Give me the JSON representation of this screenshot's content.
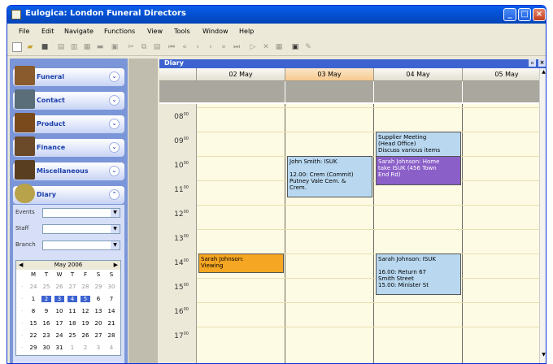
{
  "window": {
    "title": "Eulogica: London Funeral Directors"
  },
  "menu": [
    "File",
    "Edit",
    "Navigate",
    "Functions",
    "View",
    "Tools",
    "Window",
    "Help"
  ],
  "nav": [
    {
      "label": "Funeral",
      "icon": "funeral-icon",
      "color": "#8a5b2c"
    },
    {
      "label": "Contact",
      "icon": "contact-icon",
      "color": "#5a6e7a"
    },
    {
      "label": "Product",
      "icon": "product-icon",
      "color": "#7a4a1c"
    },
    {
      "label": "Finance",
      "icon": "finance-icon",
      "color": "#6b4a2a"
    },
    {
      "label": "Miscellaneous",
      "icon": "miscellaneous-icon",
      "color": "#5a3e20"
    },
    {
      "label": "Diary",
      "icon": "diary-icon",
      "color": "#b8a24a"
    }
  ],
  "filters": {
    "events": "Events",
    "staff": "Staff",
    "branch": "Branch"
  },
  "calendar": {
    "month": "May 2006",
    "weekdays": [
      "M",
      "T",
      "W",
      "T",
      "F",
      "S",
      "S"
    ],
    "weeks": [
      [
        "24",
        "25",
        "26",
        "27",
        "28",
        "29",
        "30"
      ],
      [
        "1",
        "2",
        "3",
        "4",
        "5",
        "6",
        "7"
      ],
      [
        "8",
        "9",
        "10",
        "11",
        "12",
        "13",
        "14"
      ],
      [
        "15",
        "16",
        "17",
        "18",
        "19",
        "20",
        "21"
      ],
      [
        "22",
        "23",
        "24",
        "25",
        "26",
        "27",
        "28"
      ],
      [
        "29",
        "30",
        "31",
        "1",
        "2",
        "3",
        "4"
      ]
    ],
    "selected": [
      "2",
      "3",
      "4",
      "5"
    ]
  },
  "diary": {
    "title": "Diary",
    "days": [
      "02 May",
      "03 May",
      "04 May",
      "05 May"
    ],
    "today_index": 1,
    "hours": [
      "08",
      "09",
      "10",
      "11",
      "12",
      "13",
      "14",
      "15",
      "16",
      "17"
    ]
  },
  "appointments": [
    {
      "day": 2,
      "start": 10,
      "end": 11.7,
      "color": "#b9d8f0",
      "lines": [
        "Supplier Meeting",
        "(Head Office)",
        "Discuss various items"
      ]
    },
    {
      "day": 1,
      "start": 10,
      "end": 11.7,
      "color": "#b9d8f0",
      "lines": [
        "John Smith: ISUK",
        "",
        "12.00: Crem (Commit)",
        "Putney Vale Cem. &",
        "Crem."
      ]
    },
    {
      "day": 2,
      "start": 10,
      "end": 11.2,
      "color": "#8b5fc8",
      "lines": [
        "Sarah Johnson: Home",
        "take ISUK (456 Town",
        "End Rd)"
      ]
    },
    {
      "day": 0,
      "start": 14,
      "end": 14.8,
      "color": "#f5a623",
      "lines": [
        "Sarah Johnson:",
        "Viewing"
      ]
    },
    {
      "day": 2,
      "start": 14,
      "end": 15.7,
      "color": "#b9d8f0",
      "lines": [
        "Sarah Johnson: ISUK",
        "",
        "16.00: Return 67",
        "Smith Street",
        "15.00: Minister St"
      ]
    }
  ]
}
